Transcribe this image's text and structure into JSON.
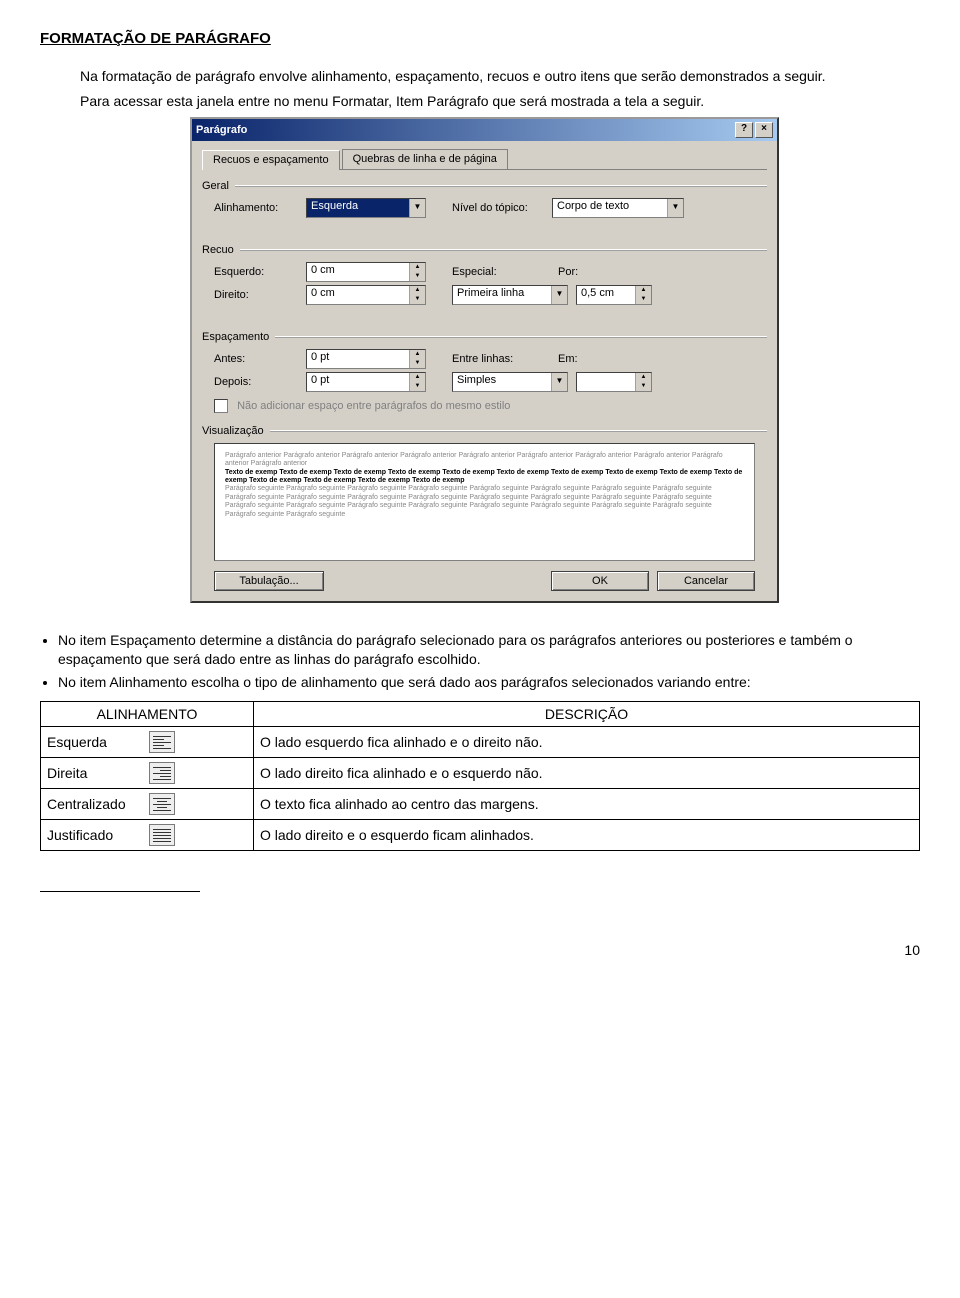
{
  "heading": "FORMATAÇÃO DE PARÁGRAFO",
  "para1": "Na formatação de parágrafo envolve alinhamento, espaçamento, recuos e outro itens que serão demonstrados a seguir.",
  "para2": "Para acessar esta janela entre no menu Formatar, Item Parágrafo que será mostrada a tela a seguir.",
  "dialog": {
    "title": "Parágrafo",
    "tab1": "Recuos e espaçamento",
    "tab2": "Quebras de linha e de página",
    "geral": {
      "group": "Geral",
      "alinhamento_label": "Alinhamento:",
      "alinhamento_value": "Esquerda",
      "nivel_label": "Nível do tópico:",
      "nivel_value": "Corpo de texto"
    },
    "recuo": {
      "group": "Recuo",
      "esq_label": "Esquerdo:",
      "esq_value": "0 cm",
      "dir_label": "Direito:",
      "dir_value": "0 cm",
      "esp_label": "Especial:",
      "esp_value": "Primeira linha",
      "por_label": "Por:",
      "por_value": "0,5 cm"
    },
    "espacamento": {
      "group": "Espaçamento",
      "antes_label": "Antes:",
      "antes_value": "0 pt",
      "depois_label": "Depois:",
      "depois_value": "0 pt",
      "entre_label": "Entre linhas:",
      "entre_value": "Simples",
      "em_label": "Em:",
      "em_value": ""
    },
    "checkbox": "Não adicionar espaço entre parágrafos do mesmo estilo",
    "visualizacao": "Visualização",
    "preview_grey1": "Parágrafo anterior Parágrafo anterior Parágrafo anterior Parágrafo anterior Parágrafo anterior Parágrafo anterior Parágrafo anterior Parágrafo anterior Parágrafo anterior Parágrafo anterior",
    "preview_black": "Texto de exemp Texto de exemp Texto de exemp Texto de exemp Texto de exemp Texto de exemp Texto de exemp Texto de exemp Texto de exemp Texto de exemp Texto de exemp Texto de exemp Texto de exemp Texto de exemp",
    "preview_grey2": "Parágrafo seguinte Parágrafo seguinte Parágrafo seguinte Parágrafo seguinte Parágrafo seguinte Parágrafo seguinte Parágrafo seguinte Parágrafo seguinte Parágrafo seguinte Parágrafo seguinte Parágrafo seguinte Parágrafo seguinte Parágrafo seguinte Parágrafo seguinte Parágrafo seguinte Parágrafo seguinte Parágrafo seguinte Parágrafo seguinte Parágrafo seguinte Parágrafo seguinte Parágrafo seguinte Parágrafo seguinte Parágrafo seguinte Parágrafo seguinte Parágrafo seguinte Parágrafo seguinte",
    "btn_tab": "Tabulação...",
    "btn_ok": "OK",
    "btn_cancel": "Cancelar"
  },
  "bullet1": "No item Espaçamento determine a distância do parágrafo selecionado para os parágrafos anteriores ou posteriores e também o espaçamento que será dado entre as linhas do parágrafo escolhido.",
  "bullet2": "No item Alinhamento escolha o tipo de alinhamento que será dado aos parágrafos selecionados variando entre:",
  "table": {
    "head1": "ALINHAMENTO",
    "head2": "DESCRIÇÃO",
    "rows": [
      {
        "label": "Esquerda",
        "desc": "O lado esquerdo fica alinhado e o direito não."
      },
      {
        "label": "Direita",
        "desc": "O lado direito fica alinhado e o esquerdo não."
      },
      {
        "label": "Centralizado",
        "desc": "O texto fica alinhado ao centro das margens."
      },
      {
        "label": "Justificado",
        "desc": "O lado direito e o esquerdo ficam alinhados."
      }
    ]
  },
  "pagenum": "10"
}
